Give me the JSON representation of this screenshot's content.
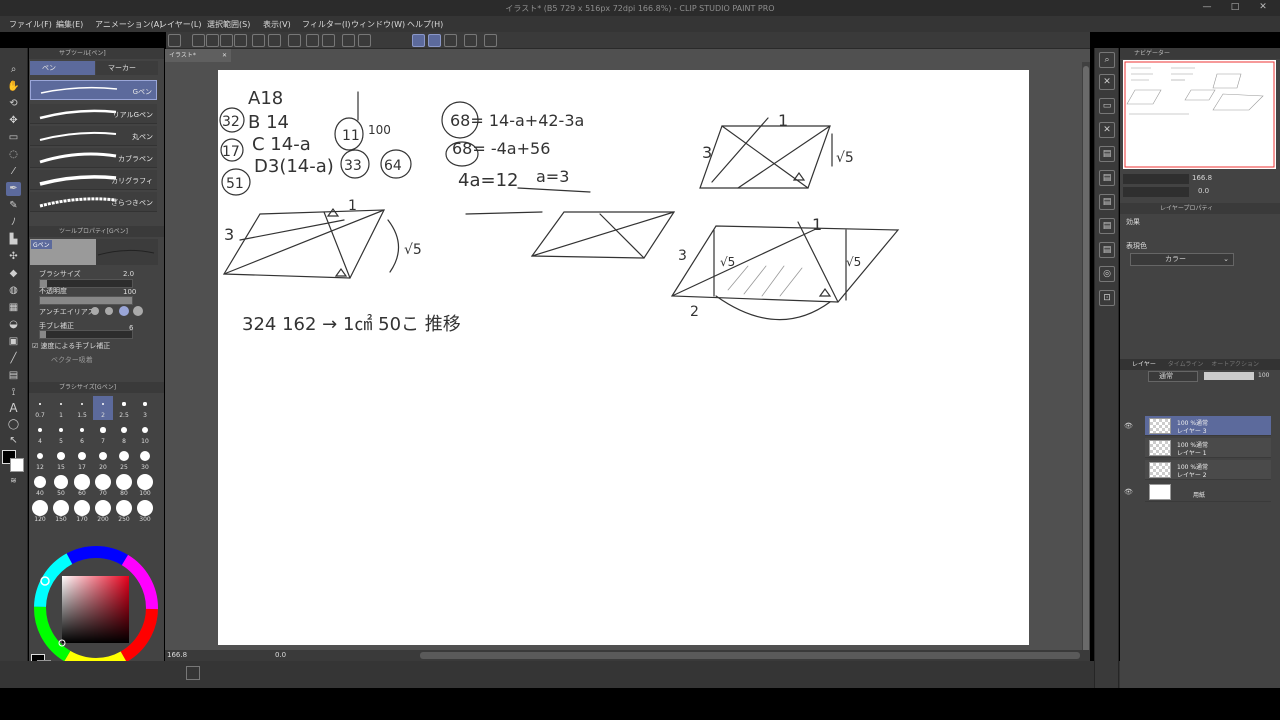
{
  "window": {
    "title": "イラスト* (B5 729 x 516px 72dpi 166.8%) - CLIP STUDIO PAINT PRO",
    "minimize": "—",
    "maximize": "□",
    "close": "✕"
  },
  "menu": [
    "ファイル(F)",
    "編集(E)",
    "アニメーション(A)",
    "レイヤー(L)",
    "選択範囲(S)",
    "表示(V)",
    "フィルター(I)",
    "ウィンドウ(W)",
    "ヘルプ(H)"
  ],
  "document_tab": "イラスト*",
  "subtool_panel": {
    "header": "サブツール[ペン]",
    "tabs": [
      "ペン",
      "マーカー"
    ],
    "brushes": [
      "Gペン",
      "リアルGペン",
      "丸ペン",
      "カブラペン",
      "カリグラフィ",
      "ざらつきペン"
    ]
  },
  "tool_property": {
    "header": "ツールプロパティ[Gペン]",
    "preview_label": "Gペン",
    "brush_size_label": "ブラシサイズ",
    "brush_size_value": "2.0",
    "opacity_label": "不透明度",
    "opacity_value": "100",
    "antialias_label": "アンチエイリアス",
    "stabilization_label": "手ブレ補正",
    "stabilization_value": "6",
    "speed_label": "速度による手ブレ補正",
    "vector_label": "ベクター吸着"
  },
  "brush_size_panel": {
    "header": "ブラシサイズ[Gペン]",
    "sizes": [
      "0.7",
      "1",
      "1.5",
      "2",
      "2.5",
      "3",
      "4",
      "5",
      "6",
      "7",
      "8",
      "10",
      "12",
      "15",
      "17",
      "20",
      "25",
      "30",
      "40",
      "50",
      "60",
      "70",
      "80",
      "100",
      "120",
      "150",
      "170",
      "200",
      "250",
      "300"
    ]
  },
  "canvas": {
    "handwriting": {
      "a18": "A18",
      "b14": "B 14",
      "c14a": "C 14-a",
      "d": "D3(14-a)",
      "n32": "32",
      "n17": "17",
      "n51": "51",
      "n11": "11",
      "n100": "100",
      "n33": "33",
      "n64": "64",
      "eq1": "68= 14-a+42-3a",
      "eq2": "68= -4a+56",
      "eq3": "4a=12",
      "eq4": "a=3",
      "bottom": "324   162 →   1㎠  50こ  推移",
      "s3a": "3",
      "s1a": "1",
      "s5a": "√5",
      "s3b": "3",
      "s1b": "1",
      "s5b": "√5",
      "s3c": "3",
      "s1c": "1",
      "s5c": "√5",
      "s5d": "√5",
      "s2": "2"
    }
  },
  "status": {
    "zoom": "166.8",
    "angle": "0.0"
  },
  "navigator": {
    "header": "ナビゲーター",
    "zoom": "166.8",
    "angle": "0.0"
  },
  "layer_property": {
    "header": "レイヤープロパティ",
    "effect_label": "効果",
    "expression_label": "表現色",
    "expression_value": "カラー"
  },
  "layers_panel": {
    "tabs": [
      "レイヤー",
      "タイムライン",
      "オートアクション"
    ],
    "blend_mode": "通常",
    "opacity": "100",
    "layers": [
      {
        "line1": "100 %通常",
        "line2": "レイヤー 3"
      },
      {
        "line1": "100 %通常",
        "line2": "レイヤー 1"
      },
      {
        "line1": "100 %通常",
        "line2": "レイヤー 2"
      },
      {
        "line1": "",
        "line2": "用紙"
      }
    ]
  },
  "icons": {
    "tools": [
      "zoom-icon",
      "hand-icon",
      "rotate-icon",
      "move-icon",
      "select-rect-icon",
      "lasso-icon",
      "eyedropper-icon",
      "pen-icon",
      "pencil-icon",
      "brush-icon",
      "airbrush-icon",
      "decoration-icon",
      "eraser-icon",
      "blend-icon",
      "fill-icon",
      "gradient-icon",
      "figure-icon",
      "frame-icon",
      "ruler-icon",
      "text-icon",
      "balloon-icon",
      "correct-line-icon"
    ]
  }
}
